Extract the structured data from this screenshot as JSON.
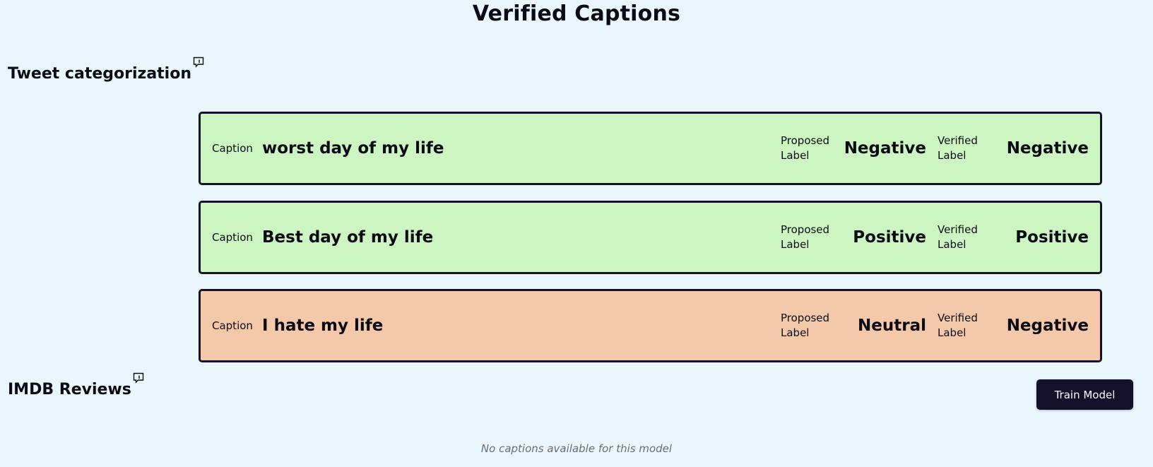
{
  "page": {
    "title": "Verified Captions"
  },
  "sections": [
    {
      "heading": "Tweet categorization",
      "info_icon": "comment-info-icon",
      "cards": [
        {
          "caption_label": "Caption",
          "caption": "worst day of my life",
          "proposed_label_title": "Proposed Label",
          "proposed_label": "Negative",
          "verified_label_title": "Verified Label",
          "verified_label": "Negative",
          "status": "match"
        },
        {
          "caption_label": "Caption",
          "caption": "Best day of my life",
          "proposed_label_title": "Proposed Label",
          "proposed_label": "Positive",
          "verified_label_title": "Verified Label",
          "verified_label": "Positive",
          "status": "match"
        },
        {
          "caption_label": "Caption",
          "caption": "I hate my life",
          "proposed_label_title": "Proposed Label",
          "proposed_label": "Neutral",
          "verified_label_title": "Verified Label",
          "verified_label": "Negative",
          "status": "mismatch"
        }
      ]
    },
    {
      "heading": "IMDB Reviews",
      "info_icon": "comment-info-icon",
      "empty_message": "No captions available for this model"
    }
  ],
  "actions": {
    "train_model_label": "Train Model"
  },
  "colors": {
    "background": "#e9f7fc",
    "match_card": "#cdf5c1",
    "mismatch_card": "#f4c9aa",
    "card_border": "#15102c",
    "button": "#15102c"
  }
}
